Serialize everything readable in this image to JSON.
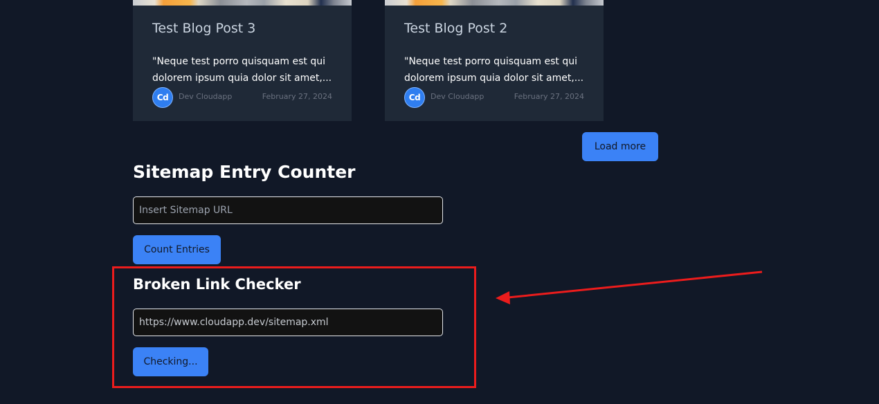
{
  "blog": {
    "cards": [
      {
        "title": "Test Blog Post 3",
        "excerpt": "\"Neque test porro quisquam est qui dolorem ipsum quia dolor sit amet,...",
        "avatar_initials": "Cd",
        "author": "Dev Cloudapp",
        "date": "February 27, 2024"
      },
      {
        "title": "Test Blog Post 2",
        "excerpt": "\"Neque test porro quisquam est qui dolorem ipsum quia dolor sit amet,...",
        "avatar_initials": "Cd",
        "author": "Dev Cloudapp",
        "date": "February 27, 2024"
      }
    ],
    "load_more_label": "Load more"
  },
  "sitemap_counter": {
    "title": "Sitemap Entry Counter",
    "input_value": "",
    "input_placeholder": "Insert Sitemap URL",
    "button_label": "Count Entries"
  },
  "broken_link_checker": {
    "title": "Broken Link Checker",
    "input_value": "https://www.cloudapp.dev/sitemap.xml",
    "button_label": "Checking..."
  },
  "colors": {
    "background": "#111827",
    "card": "#1f2937",
    "accent": "#3b82f6",
    "annotation": "#ec1c1c"
  }
}
